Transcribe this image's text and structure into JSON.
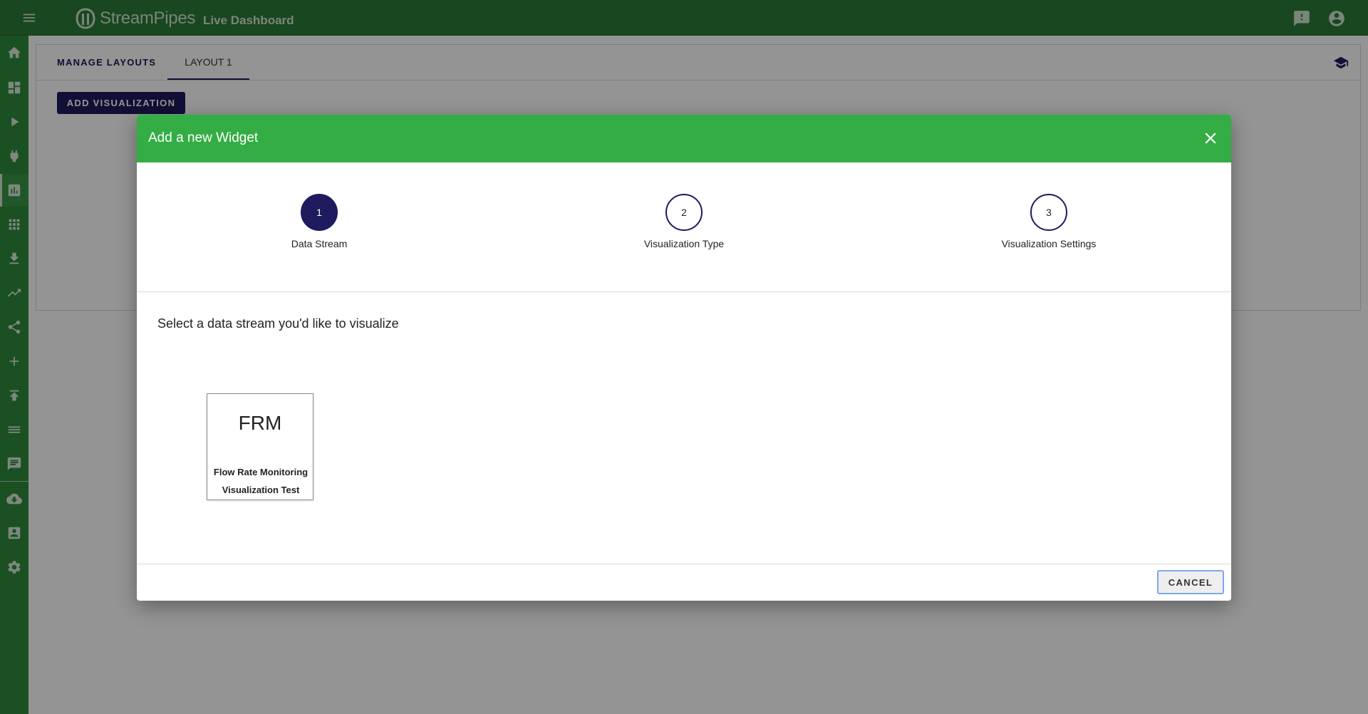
{
  "app": {
    "name": "StreamPipes",
    "page_title": "Live Dashboard"
  },
  "topbar": {
    "icons": [
      "menu-icon",
      "feedback-icon",
      "account-icon"
    ]
  },
  "sidebar": {
    "items": [
      {
        "icon": "home-icon"
      },
      {
        "icon": "dashboard-icon"
      },
      {
        "icon": "play-icon"
      },
      {
        "icon": "plug-icon"
      },
      {
        "icon": "bar-chart-icon",
        "active": true
      },
      {
        "icon": "apps-grid-icon"
      },
      {
        "icon": "download-icon"
      },
      {
        "icon": "trending-icon"
      },
      {
        "icon": "share-icon"
      },
      {
        "icon": "add-icon"
      },
      {
        "icon": "upload-icon"
      },
      {
        "icon": "list-icon"
      },
      {
        "icon": "comment-icon"
      },
      {
        "icon": "cloud-download-icon"
      },
      {
        "icon": "contact-icon"
      },
      {
        "icon": "settings-icon"
      }
    ]
  },
  "tabs": {
    "manage": "MANAGE LAYOUTS",
    "layout": "LAYOUT 1"
  },
  "toolbar": {
    "add_visualization": "ADD VISUALIZATION"
  },
  "dialog": {
    "title": "Add a new Widget",
    "steps": [
      {
        "number": "1",
        "label": "Data Stream",
        "active": true
      },
      {
        "number": "2",
        "label": "Visualization Type",
        "active": false
      },
      {
        "number": "3",
        "label": "Visualization Settings",
        "active": false
      }
    ],
    "instruction": "Select a data stream you'd like to visualize",
    "streams": [
      {
        "abbr": "FRM",
        "name": "Flow Rate Monitoring Visualization Test"
      }
    ],
    "cancel_label": "CANCEL"
  },
  "colors": {
    "topbar": "#2b7a36",
    "sidebar": "#2e8a3b",
    "dialog_header": "#33ad44",
    "primary": "#1e1b5e"
  }
}
